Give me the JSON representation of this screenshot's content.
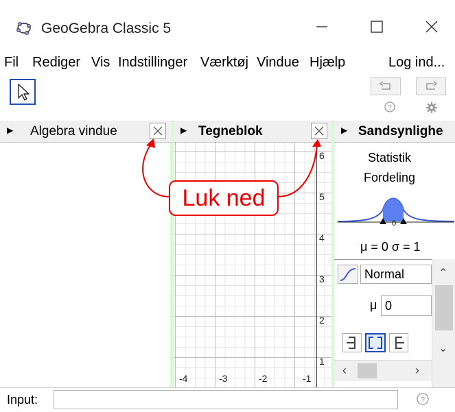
{
  "window": {
    "title": "GeoGebra Classic 5"
  },
  "menu": {
    "items": [
      "Fil",
      "Rediger",
      "Vis",
      "Indstillinger",
      "Værktøj",
      "Vindue",
      "Hjælp"
    ],
    "login": "Log ind..."
  },
  "panels": {
    "algebra": {
      "title": "Algebra vindue"
    },
    "graphics": {
      "title": "Tegneblok",
      "x_ticks": [
        "-4",
        "-3",
        "-2",
        "-1"
      ],
      "y_ticks": [
        "6",
        "5",
        "4",
        "3",
        "2",
        "1"
      ]
    },
    "probability": {
      "title": "Sandsynlighe",
      "tabs": {
        "stats": "Statistik",
        "dist": "Fordeling"
      },
      "curve_label": "0",
      "params_line": "μ = 0   σ = 1",
      "distribution": "Normal",
      "mu_label": "μ",
      "mu_value": "0"
    }
  },
  "callout": {
    "text": "Luk ned"
  },
  "input": {
    "label": "Input:",
    "placeholder": ""
  },
  "colors": {
    "accent": "#1d4bb8",
    "annotation": "#e00000",
    "background": "#d6fbd2"
  }
}
